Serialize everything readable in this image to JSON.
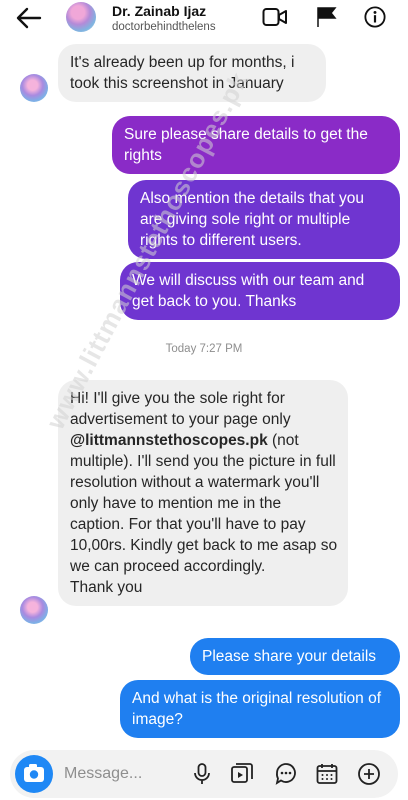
{
  "header": {
    "name": "Dr. Zainab Ijaz",
    "username": "doctorbehindthelens"
  },
  "messages": {
    "m1": "It's already been up for months, i took this screenshot in January",
    "m2": "Sure please share details to get the rights",
    "m3": "Also mention the details that you are giving sole right or multiple rights to different users.",
    "m4": "We will discuss with our team and get back to you. Thanks",
    "timestamp": "Today 7:27 PM",
    "m5_part1": "Hi! I'll give you the sole right for advertisement to your page only",
    "m5_handle": "@littmannstethoscopes.pk",
    "m5_part2": "(not multiple). I'll send you the picture in full resolution without a watermark you'll only have to mention me in the caption. For that you'll have to pay 10,00rs. Kindly get back to me asap so we can proceed accordingly.",
    "m5_thanks": "Thank you",
    "m6": "Please share your details",
    "m7": "And what is the original resolution of image?"
  },
  "watermark": "www.littmannstethoscopes.pk",
  "composer": {
    "placeholder": "Message..."
  },
  "icons": [
    "back-arrow-icon",
    "video-call-icon",
    "flag-icon",
    "info-icon",
    "camera-icon",
    "microphone-icon",
    "gallery-icon",
    "sticker-icon",
    "calendar-icon",
    "plus-icon"
  ],
  "colors": {
    "outgoing_purple": "#8a2bc7",
    "outgoing_violet": "#6f35d0",
    "outgoing_blue": "#1f7ff0",
    "incoming_gray": "#efefef",
    "camera_blue": "#1f88f5"
  }
}
